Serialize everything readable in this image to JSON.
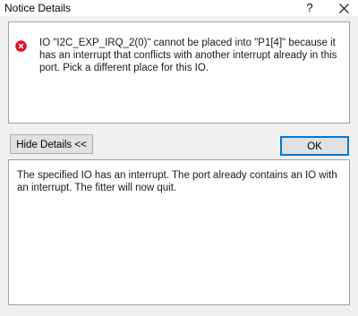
{
  "window": {
    "title": "Notice Details",
    "help_glyph": "?",
    "close_icon": "close-icon"
  },
  "message": {
    "icon": "error-icon",
    "icon_color": "#e81123",
    "text": "IO \"I2C_EXP_IRQ_2(0)\" cannot be placed into \"P1[4]\" because it has an interrupt that conflicts with another interrupt already in this port. Pick a different place for this IO."
  },
  "buttons": {
    "hide_details_label": "Hide Details <<",
    "ok_label": "OK"
  },
  "details": {
    "text": "The specified IO has an interrupt. The port already contains an IO with an interrupt. The fitter will now quit."
  },
  "colors": {
    "accent": "#0078d7",
    "window_background": "#f0f0f0",
    "panel_background": "#ffffff"
  }
}
